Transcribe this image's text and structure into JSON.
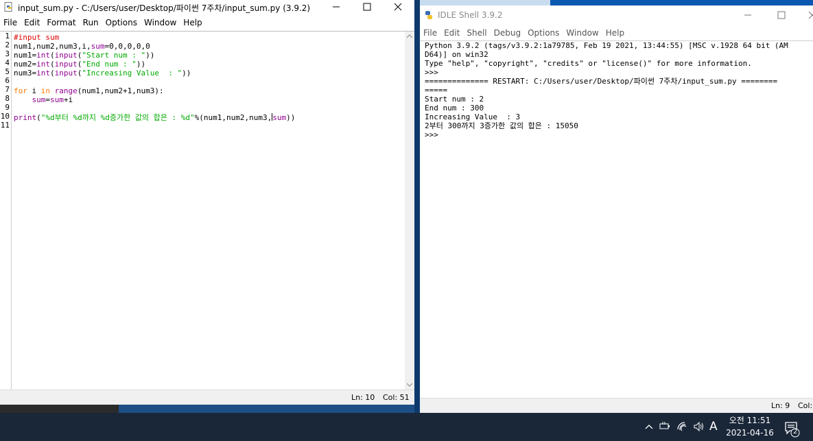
{
  "editor": {
    "title": "input_sum.py - C:/Users/user/Desktop/파이썬 7주차/input_sum.py (3.9.2)",
    "menu": [
      "File",
      "Edit",
      "Format",
      "Run",
      "Options",
      "Window",
      "Help"
    ],
    "line_numbers": [
      "1",
      "2",
      "3",
      "4",
      "5",
      "6",
      "7",
      "8",
      "9",
      "10",
      "11"
    ],
    "status": {
      "ln": "Ln: 10",
      "col": "Col: 51"
    }
  },
  "shell": {
    "title": "IDLE Shell 3.9.2",
    "menu": [
      "File",
      "Edit",
      "Shell",
      "Debug",
      "Options",
      "Window",
      "Help"
    ],
    "lines": [
      {
        "text": "Python 3.9.2 (tags/v3.9.2:1a79785, Feb 19 2021, 13:44:55) [MSC v.1928 64 bit (AM",
        "kind": "plain"
      },
      {
        "text": "D64)] on win32",
        "kind": "plain"
      },
      {
        "text": "Type \"help\", \"copyright\", \"credits\" or \"license()\" for more information.",
        "kind": "plain"
      },
      {
        "text": ">>> ",
        "kind": "prompt"
      },
      {
        "text": "============== RESTART: C:/Users/user/Desktop/파이썬 7주차/input_sum.py ========",
        "kind": "plain"
      },
      {
        "text": "=====",
        "kind": "plain"
      },
      {
        "text": "Start num : 2",
        "kind": "stdout"
      },
      {
        "text": "End num : 300",
        "kind": "stdout"
      },
      {
        "text": "Increasing Value  : 3",
        "kind": "stdout"
      },
      {
        "text": "2부터 300까지 3증가한 값의 합은 : 15050",
        "kind": "stdout"
      },
      {
        "text": ">>> ",
        "kind": "prompt"
      }
    ],
    "status": {
      "ln": "Ln: 9",
      "col": "Col:"
    }
  },
  "taskbar": {
    "time": "오전 11:51",
    "date": "2021-04-16",
    "ime": "A",
    "notification_count": "2"
  },
  "colors": {
    "keyword": "#ff7700",
    "builtin": "#900090",
    "string": "#00aa00",
    "comment": "#dd0000",
    "shell_output": "#1b1b9e",
    "prompt": "#a00000"
  }
}
